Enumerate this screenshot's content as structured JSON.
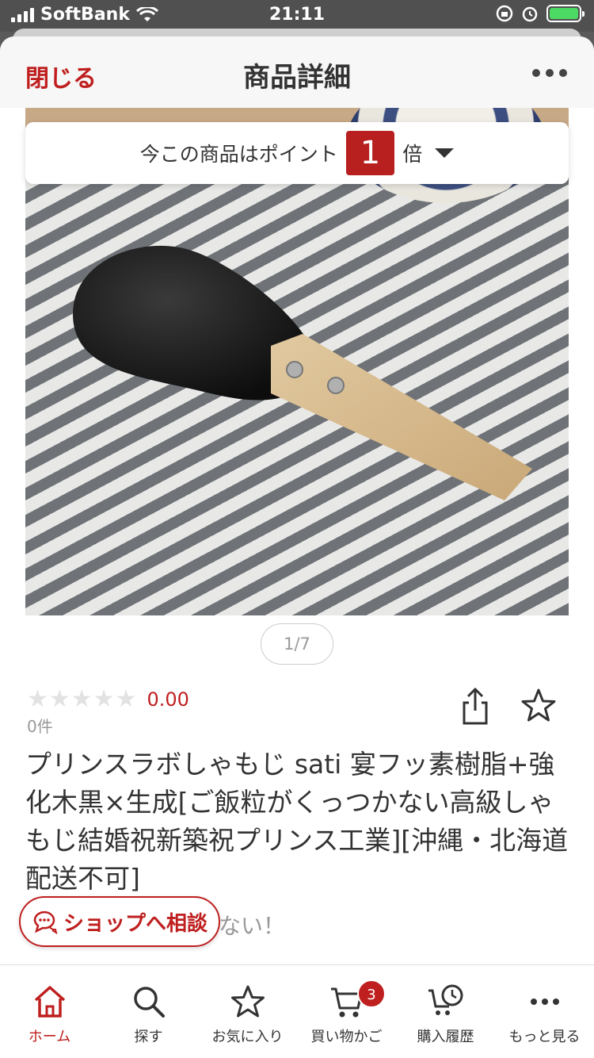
{
  "status_bar": {
    "carrier": "SoftBank",
    "time": "21:11"
  },
  "header": {
    "close_label": "閉じる",
    "title": "商品詳細"
  },
  "points_banner": {
    "prefix": "今この商品はポイント",
    "multiplier": "1",
    "suffix": "倍"
  },
  "gallery": {
    "page_indicator": "1/7"
  },
  "rating": {
    "stars_filled": 0,
    "stars_total": 5,
    "score": "0.00",
    "review_count": "0件"
  },
  "product": {
    "title": "プリンスラボしゃもじ sati 宴フッ素樹脂+強化木黒×生成[ご飯粒がくっつかない高級しゃもじ結婚祝新築祝プリンス工業][沖縄・北海道配送不可]",
    "partial_text": "ない！"
  },
  "consult": {
    "label": "ショップへ相談"
  },
  "tab_bar": {
    "items": [
      {
        "label": "ホーム",
        "icon": "home-icon"
      },
      {
        "label": "探す",
        "icon": "search-icon"
      },
      {
        "label": "お気に入り",
        "icon": "star-icon"
      },
      {
        "label": "買い物かご",
        "icon": "cart-icon",
        "badge": "3"
      },
      {
        "label": "購入履歴",
        "icon": "history-icon"
      },
      {
        "label": "もっと見る",
        "icon": "more-icon"
      }
    ]
  },
  "colors": {
    "accent": "#bf1f1f"
  }
}
